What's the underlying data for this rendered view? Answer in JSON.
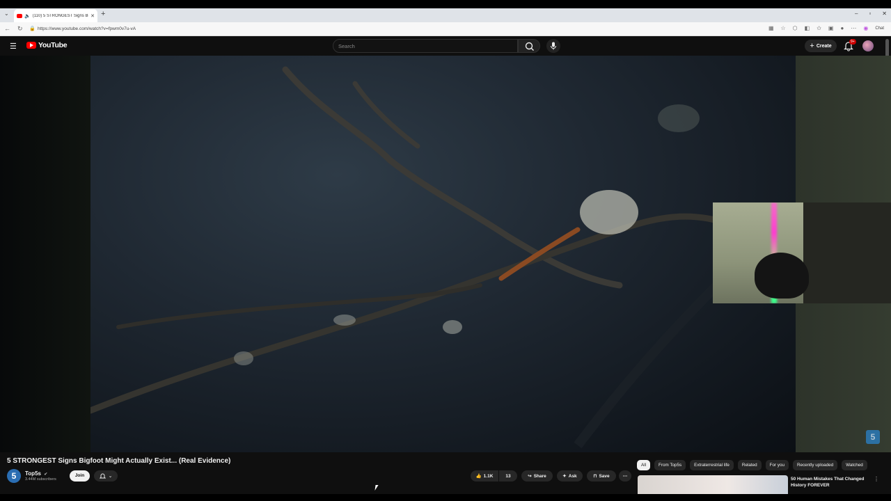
{
  "browser": {
    "tab_title": "(110) 5 STRONGEST Signs Bi...",
    "new_tab": "+",
    "url": "https://www.youtube.com/watch?v=fpwm0v7u-vA",
    "chat_label": "Chat",
    "window_controls": [
      "–",
      "▫",
      "✕"
    ]
  },
  "youtube": {
    "logo_text": "YouTube",
    "search": {
      "placeholder": "Search"
    },
    "create_label": "Create",
    "notification_count": "9+"
  },
  "video": {
    "title": "5 STRONGEST Signs Bigfoot Might Actually Exist... (Real Evidence)",
    "channel": {
      "name": "Top5s",
      "subscribers": "3.44M subscribers",
      "avatar_letter": "5"
    },
    "join_label": "Join",
    "likes": "1.1K",
    "dislikes": "13",
    "share_label": "Share",
    "ask_label": "Ask",
    "save_label": "Save",
    "watermark": "5"
  },
  "sidebar": {
    "chips": [
      "All",
      "From Top5s",
      "Extraterrestrial life",
      "Related",
      "For you",
      "Recently uploaded",
      "Watched"
    ],
    "recommendation": {
      "title": "50 Human Mistakes That Changed History FOREVER"
    }
  }
}
